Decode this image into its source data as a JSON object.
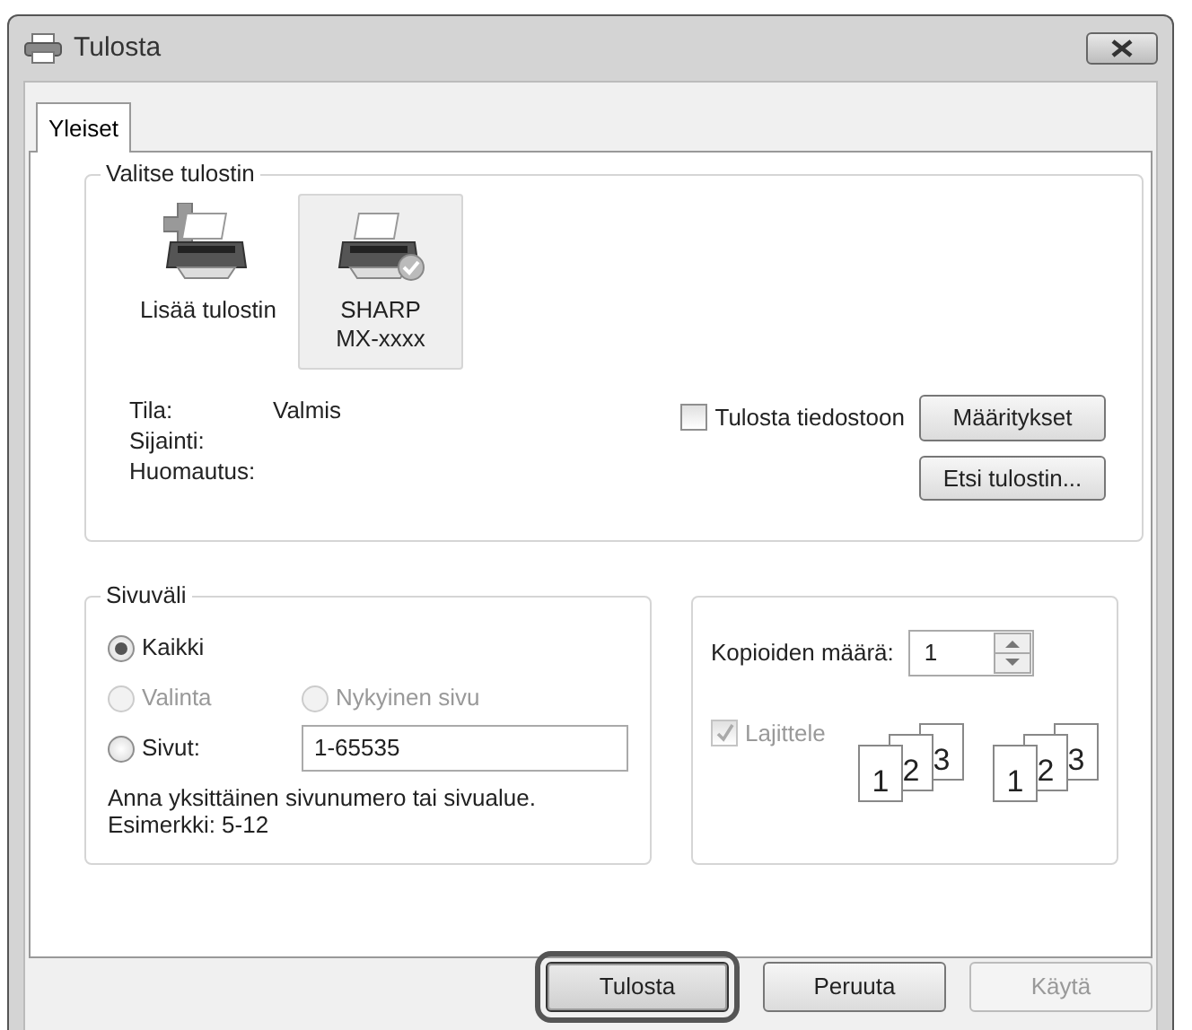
{
  "window": {
    "title": "Tulosta"
  },
  "tabs": [
    {
      "label": "Yleiset",
      "selected": true
    }
  ],
  "printer_group": {
    "title": "Valitse tulostin",
    "printers": [
      {
        "kind": "add",
        "lines": [
          "Lisää tulostin"
        ],
        "selected": false
      },
      {
        "kind": "printer",
        "lines": [
          "SHARP",
          "MX-xxxx"
        ],
        "selected": true
      }
    ],
    "info": [
      {
        "label": "Tila:",
        "value": "Valmis"
      },
      {
        "label": "Sijainti:"
      },
      {
        "label": "Huomautus:"
      }
    ],
    "print_to_file": {
      "label": "Tulosta tiedostoon",
      "checked": false
    },
    "preferences_button": "Määritykset",
    "find_button": "Etsi tulostin..."
  },
  "page_range": {
    "title": "Sivuväli",
    "rows": [
      {
        "options": [
          {
            "label": "Kaikki",
            "selected": true,
            "disabled": false
          }
        ]
      },
      {
        "options": [
          {
            "label": "Valinta",
            "selected": false,
            "disabled": true
          },
          {
            "label": "Nykyinen sivu",
            "selected": false,
            "disabled": true
          }
        ]
      },
      {
        "options": [
          {
            "label": "Sivut:",
            "selected": false,
            "disabled": false,
            "field_value": "1-65535"
          }
        ]
      }
    ],
    "hint": [
      "Anna yksittäinen sivunumero tai sivualue.",
      "Esimerkki: 5-12"
    ]
  },
  "copies": {
    "label": "Kopioiden määrä:",
    "value": "1",
    "collate": {
      "label": "Lajittele",
      "checked": true,
      "disabled": true
    },
    "collate_sets": [
      [
        "1",
        "2",
        "3"
      ],
      [
        "1",
        "2",
        "3"
      ]
    ]
  },
  "buttons": [
    {
      "label": "Tulosta",
      "default": true,
      "disabled": false
    },
    {
      "label": "Peruuta",
      "default": false,
      "disabled": false
    },
    {
      "label": "Käytä",
      "default": false,
      "disabled": true
    }
  ]
}
